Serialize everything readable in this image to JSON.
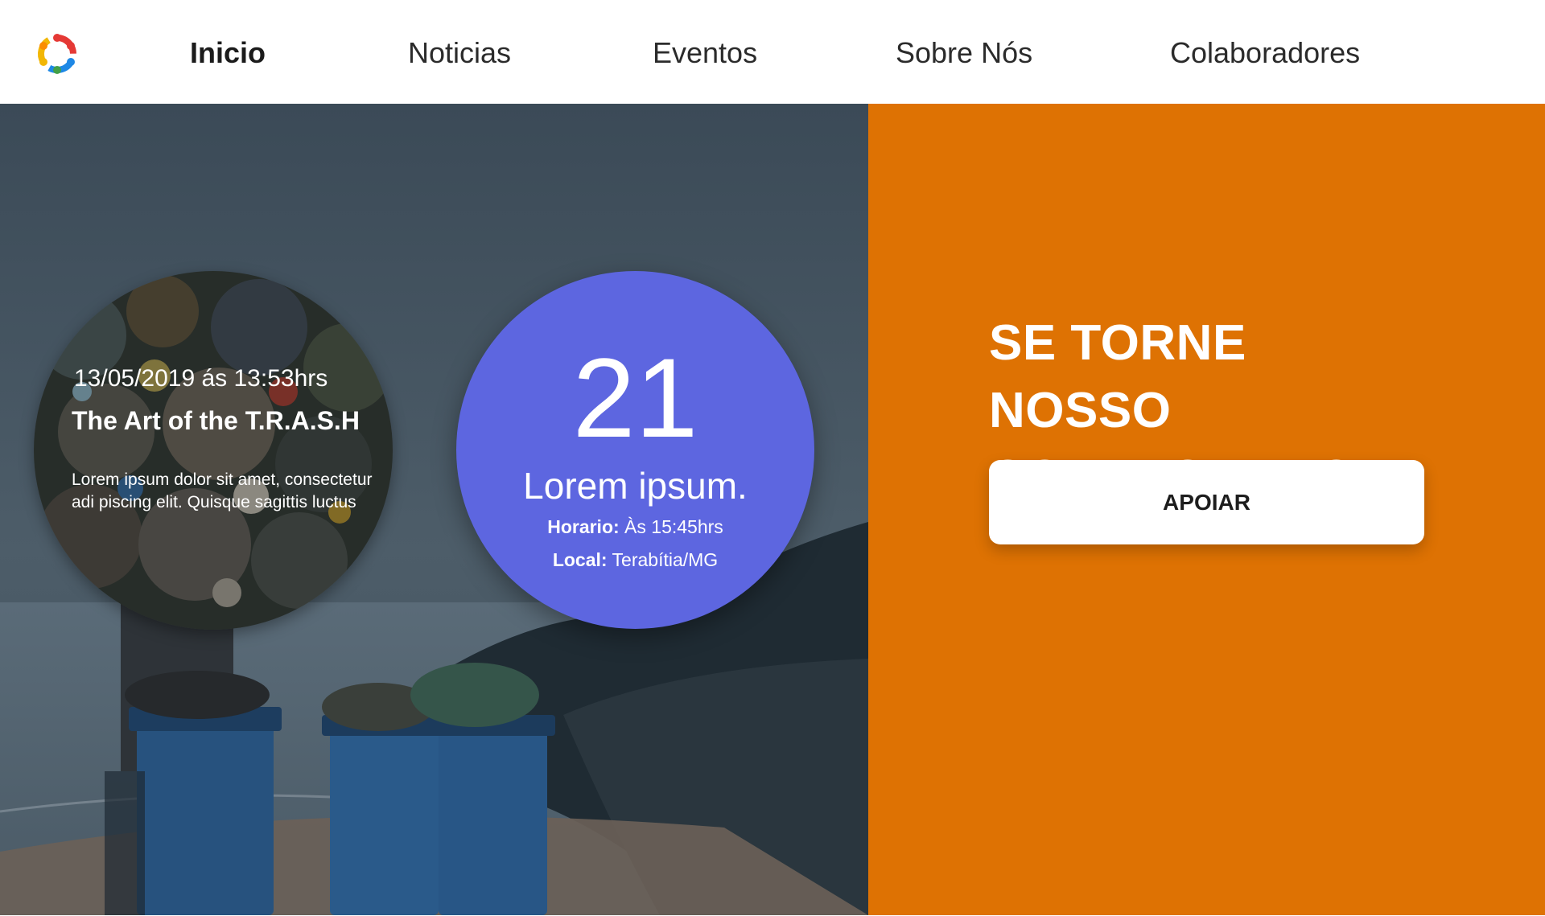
{
  "nav": {
    "items": [
      {
        "label": "Inicio",
        "active": true
      },
      {
        "label": "Noticias",
        "active": false
      },
      {
        "label": "Eventos",
        "active": false
      },
      {
        "label": "Sobre Nós",
        "active": false
      },
      {
        "label": "Colaboradores",
        "active": false
      }
    ]
  },
  "event": {
    "date": "13/05/2019 ás 13:53hrs",
    "title": "The Art of the T.R.A.S.H",
    "description": "Lorem ipsum dolor sit amet, consectetur adi piscing elit. Quisque sagittis luctus"
  },
  "day_card": {
    "day": "21",
    "title": "Lorem ipsum.",
    "horario_label": "Horario:",
    "horario_value": "Às 15:45hrs",
    "local_label": "Local:",
    "local_value": "Terabítia/MG"
  },
  "cta": {
    "heading": "SE TORNE NOSSO COLABORADOR",
    "button_label": "APOIAR"
  },
  "colors": {
    "accent_orange": "#de7203",
    "card_blue": "#5d66e0"
  }
}
